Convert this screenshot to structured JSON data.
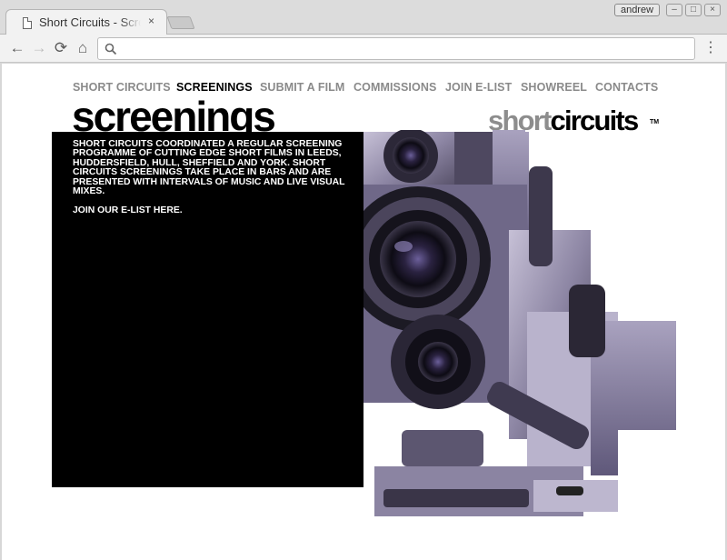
{
  "browser": {
    "tab_title": "Short Circuits - Screenings",
    "tab_close": "×",
    "user_badge": "andrew",
    "window_minimize": "–",
    "window_maximize": "□",
    "window_close": "×",
    "omnibox": {
      "value": "",
      "placeholder": ""
    },
    "icons": {
      "back": "←",
      "forward": "→",
      "reload": "⟳",
      "home": "⌂",
      "menu": "⋮"
    }
  },
  "site": {
    "nav": [
      {
        "label": "SHORT CIRCUITS",
        "active": false
      },
      {
        "label": "SCREENINGS",
        "active": true
      },
      {
        "label": "SUBMIT A FILM",
        "active": false
      },
      {
        "label": "COMMISSIONS",
        "active": false
      },
      {
        "label": "JOIN E-LIST",
        "active": false
      },
      {
        "label": "SHOWREEL",
        "active": false
      },
      {
        "label": "CONTACTS",
        "active": false
      }
    ],
    "heading": "screenings",
    "logo": {
      "part1": "short",
      "part2": "circuits",
      "tm": "TM"
    },
    "intro": "SHORT CIRCUITS COORDINATED A REGULAR SCREENING PROGRAMME OF CUTTING EDGE SHORT FILMS IN LEEDS, HUDDERSFIELD, HULL, SHEFFIELD AND YORK. SHORT CIRCUITS SCREENINGS TAKE PLACE IN BARS AND ARE PRESENTED WITH INTERVALS OF MUSIC AND LIVE VISUAL MIXES.",
    "elist_link": "JOIN OUR E-LIST HERE."
  },
  "colors": {
    "nav_inactive": "#8a8a8a",
    "nav_active": "#000000",
    "panel": "#000000",
    "camera_tint": "#8a84a0"
  }
}
